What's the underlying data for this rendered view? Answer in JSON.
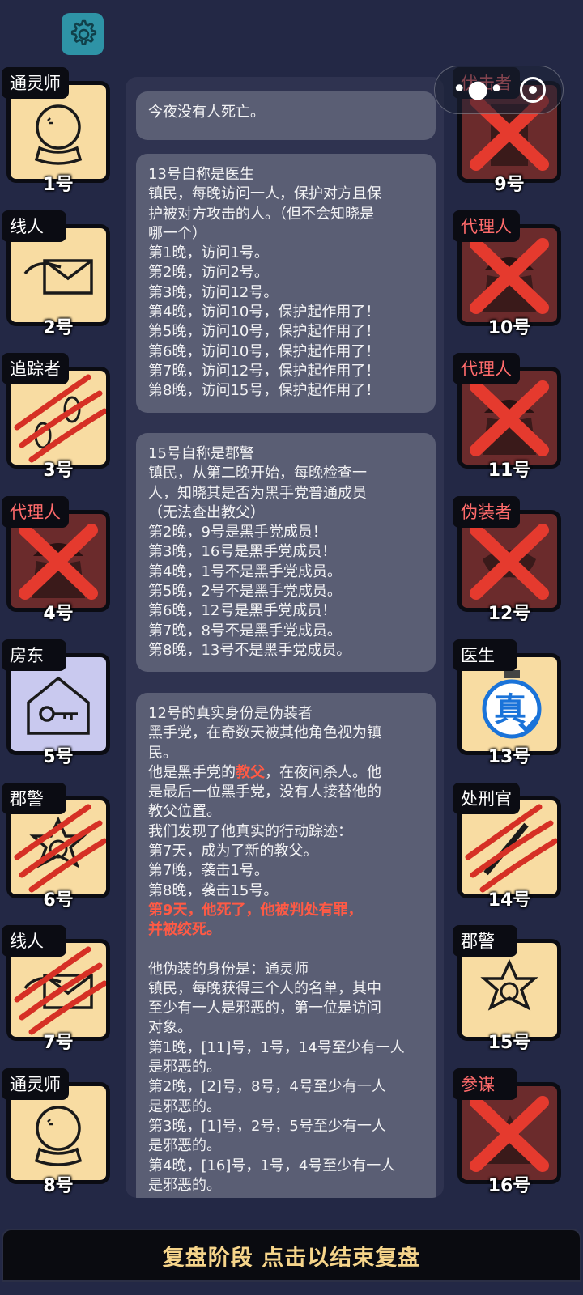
{
  "header": {
    "settings_icon": "gear-icon"
  },
  "capsule": {
    "menu_icon": "more-dots-icon",
    "close_icon": "target-icon"
  },
  "left_players": [
    {
      "role": "通灵师",
      "number": "1号",
      "status": "alive",
      "icon": "crystal-ball-icon"
    },
    {
      "role": "线人",
      "number": "2号",
      "status": "alive",
      "icon": "envelope-hand-icon"
    },
    {
      "role": "追踪者",
      "number": "3号",
      "status": "scratched",
      "icon": "footprints-icon"
    },
    {
      "role": "代理人",
      "number": "4号",
      "status": "dead",
      "icon": "agent-icon"
    },
    {
      "role": "房东",
      "number": "5号",
      "status": "alive",
      "icon": "house-key-icon"
    },
    {
      "role": "郡警",
      "number": "6号",
      "status": "scratched",
      "icon": "sheriff-star-icon"
    },
    {
      "role": "线人",
      "number": "7号",
      "status": "scratched",
      "icon": "envelope-hand-icon"
    },
    {
      "role": "通灵师",
      "number": "8号",
      "status": "alive",
      "icon": "crystal-ball-icon"
    }
  ],
  "right_players": [
    {
      "role": "伏击者",
      "number": "9号",
      "status": "dead",
      "icon": "door-icon"
    },
    {
      "role": "代理人",
      "number": "10号",
      "status": "dead",
      "icon": "agent-icon"
    },
    {
      "role": "代理人",
      "number": "11号",
      "status": "dead",
      "icon": "agent-icon"
    },
    {
      "role": "伪装者",
      "number": "12号",
      "status": "dead",
      "icon": "mask-icon"
    },
    {
      "role": "医生",
      "number": "13号",
      "status": "verified",
      "icon": "doctor-verified-icon",
      "badge": "真"
    },
    {
      "role": "处刑官",
      "number": "14号",
      "status": "scratched",
      "icon": "executioner-icon"
    },
    {
      "role": "郡警",
      "number": "15号",
      "status": "alive",
      "icon": "sheriff-star-icon"
    },
    {
      "role": "参谋",
      "number": "16号",
      "status": "dead",
      "icon": "advisor-icon"
    }
  ],
  "log": {
    "msg1": "今夜没有人死亡。",
    "msg2": {
      "lines": [
        "13号自称是医生",
        "镇民，每晚访问一人，保护对方且保",
        "护被对方攻击的人。（但不会知晓是",
        "哪一个）",
        "第1晚，访问1号。",
        "第2晚，访问2号。",
        "第3晚，访问12号。",
        "第4晚，访问10号，保护起作用了！",
        "第5晚，访问10号，保护起作用了！",
        "第6晚，访问10号，保护起作用了！",
        "第7晚，访问12号，保护起作用了！",
        "第8晚，访问15号，保护起作用了！"
      ]
    },
    "msg3": {
      "lines": [
        "15号自称是郡警",
        "镇民，从第二晚开始，每晚检查一",
        "人，知晓其是否为黑手党普通成员",
        "（无法查出教父）",
        "第2晚，9号是黑手党成员！",
        "第3晚，16号是黑手党成员！",
        "第4晚，1号不是黑手党成员。",
        "第5晚，2号不是黑手党成员。",
        "第6晚，12号是黑手党成员！",
        "第7晚，8号不是黑手党成员。",
        "第8晚，13号不是黑手党成员。"
      ]
    },
    "msg4": {
      "l1": "12号的真实身份是伪装者",
      "l2": "黑手党，在奇数天被其他角色视为镇",
      "l3": "民。",
      "l4a": "他是黑手党的",
      "l4b": "教父",
      "l4c": "，在夜间杀人。他",
      "l5": "是最后一位黑手党，没有人接替他的",
      "l6": "教父位置。",
      "l7": "我们发现了他真实的行动踪迹：",
      "l8": "第7天，成为了新的教父。",
      "l9": "第7晚，袭击1号。",
      "l10": "第8晚，袭击15号。",
      "l11": "第9天，他死了，他被判处有罪，",
      "l12": "并被绞死。",
      "l13": "他伪装的身份是：通灵师",
      "l14": "镇民，每晚获得三个人的名单，其中",
      "l15": "至少有一人是邪恶的，第一位是访问",
      "l16": "对象。",
      "l17": "第1晚，[11]号，1号，14号至少有一人",
      "l18": "是邪恶的。",
      "l19": "第2晚，[2]号，8号，4号至少有一人",
      "l20": "是邪恶的。",
      "l21": "第3晚，[1]号，2号，5号至少有一人",
      "l22": "是邪恶的。",
      "l23": "第4晚，[16]号，1号，4号至少有一人",
      "l24": "是邪恶的。"
    }
  },
  "bottom": {
    "label": "复盘阶段 点击以结束复盘"
  },
  "colors": {
    "background": "#232845",
    "card": "#f8dca2",
    "dead_card": "#6b2b2c",
    "accent_red": "#ff5a45",
    "bottom_text": "#f5d48a"
  }
}
